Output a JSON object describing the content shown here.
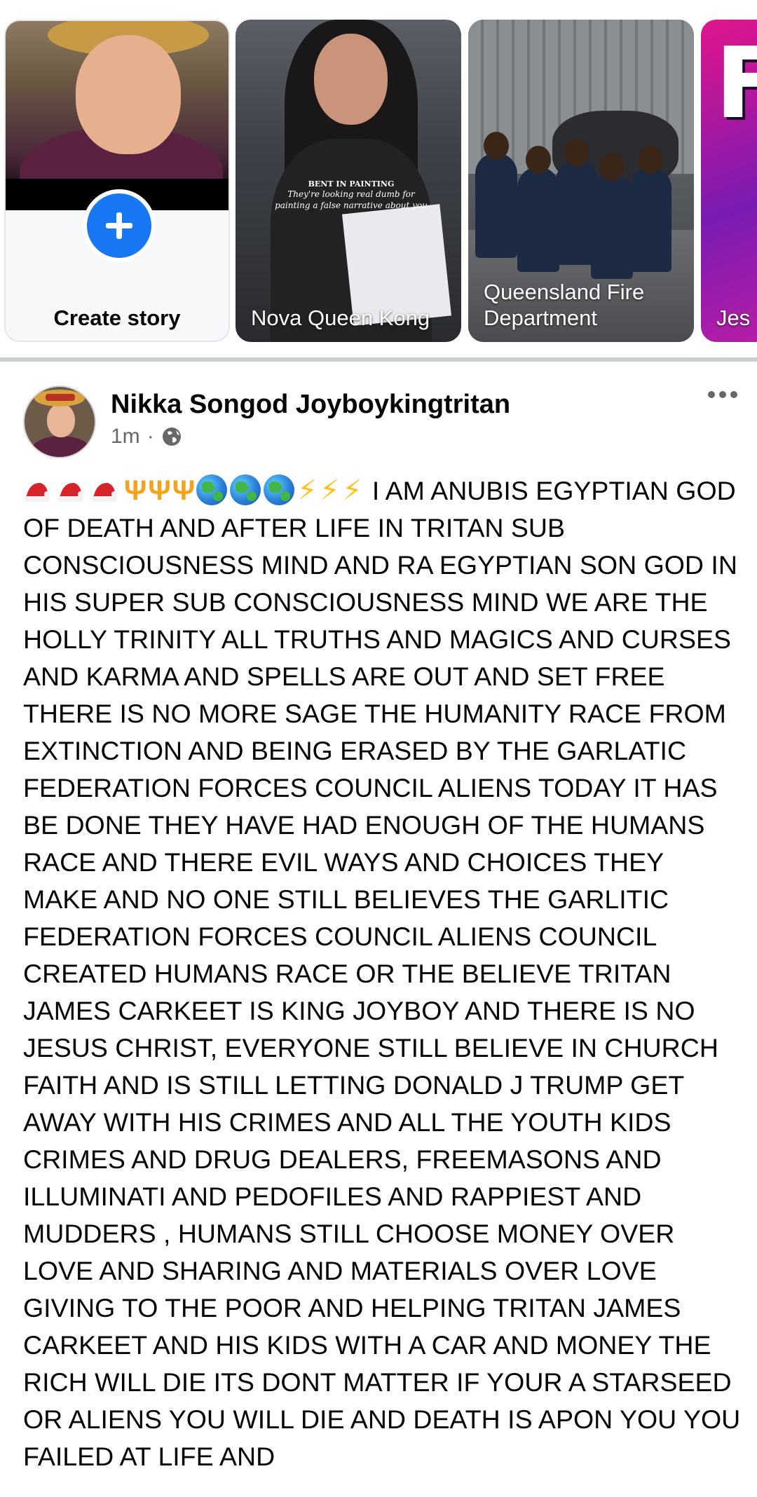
{
  "stories": [
    {
      "name": "Create story",
      "type": "create"
    },
    {
      "name": "Nova Queen Kong",
      "type": "user"
    },
    {
      "name": "Queensland Fire Department",
      "type": "page"
    },
    {
      "name": "Jes",
      "type": "user"
    }
  ],
  "nova_overlay": {
    "heading": "BENT IN PAINTING",
    "line1": "They're looking real dumb for",
    "line2": "painting a false narrative about you"
  },
  "post": {
    "author": "Nikka Songod Joyboykingtritan",
    "time": "1m",
    "privacy_icon": "globe-icon",
    "emojis": [
      "santa-hat",
      "santa-hat",
      "santa-hat",
      "trident",
      "trident",
      "trident",
      "globe",
      "globe",
      "globe",
      "lightning",
      "lightning",
      "lightning"
    ],
    "text": "I AM ANUBIS EGYPTIAN GOD OF DEATH AND AFTER LIFE IN TRITAN SUB CONSCIOUSNESS MIND AND RA EGYPTIAN SON GOD IN HIS SUPER SUB CONSCIOUSNESS MIND WE ARE THE HOLLY TRINITY ALL TRUTHS AND MAGICS AND CURSES AND KARMA AND SPELLS ARE OUT AND SET FREE THERE IS NO MORE SAGE THE HUMANITY RACE FROM EXTINCTION AND BEING ERASED BY THE GARLATIC FEDERATION FORCES COUNCIL ALIENS TODAY IT HAS BE DONE THEY HAVE HAD ENOUGH OF THE HUMANS RACE AND THERE EVIL WAYS AND CHOICES THEY MAKE AND NO ONE STILL BELIEVES THE GARLITIC FEDERATION FORCES COUNCIL ALIENS COUNCIL CREATED HUMANS RACE OR THE BELIEVE TRITAN JAMES CARKEET IS KING JOYBOY AND THERE IS NO JESUS CHRIST, EVERYONE STILL BELIEVE IN CHURCH FAITH AND IS STILL LETTING DONALD J TRUMP GET AWAY WITH HIS CRIMES AND ALL THE YOUTH KIDS CRIMES AND DRUG DEALERS, FREEMASONS AND ILLUMINATI AND PEDOFILES AND RAPPIEST AND MUDDERS , HUMANS STILL CHOOSE MONEY OVER LOVE AND SHARING AND MATERIALS OVER LOVE GIVING TO THE POOR AND HELPING TRITAN JAMES CARKEET AND HIS KIDS WITH A CAR AND MONEY THE RICH WILL DIE ITS DONT MATTER IF YOUR A STARSEED OR ALIENS YOU WILL DIE AND DEATH IS APON YOU YOU FAILED AT LIFE AND"
  },
  "colors": {
    "accent": "#1877f2",
    "text_primary": "#050505",
    "text_secondary": "#65676b",
    "separator": "#c9ccd1"
  }
}
